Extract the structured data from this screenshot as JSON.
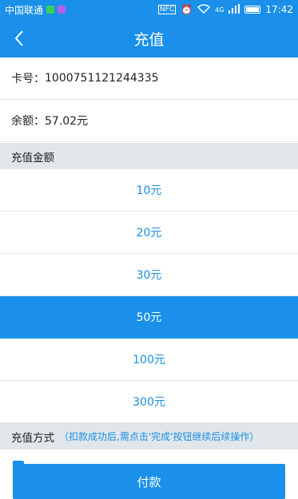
{
  "status_bar": {
    "carrier": "中国联通",
    "network": "4G",
    "time": "17:42"
  },
  "header": {
    "title": "充值"
  },
  "card": {
    "number_label": "卡号：",
    "number": "1000751121244335",
    "balance_label": "余额：",
    "balance": "57.02元"
  },
  "amount_section": {
    "title": "充值金额",
    "options": [
      "10元",
      "20元",
      "30元",
      "50元",
      "100元",
      "300元"
    ],
    "selected": "50元"
  },
  "method_section": {
    "title": "充值方式",
    "hint": "（扣款成功后,需点击'完成'按钮继续后续操作）"
  },
  "pay_button": {
    "label": "付款"
  },
  "colors": {
    "primary": "#1a90ea",
    "accent_text": "#1a8fe3",
    "section_bg": "#e1e6eb"
  }
}
